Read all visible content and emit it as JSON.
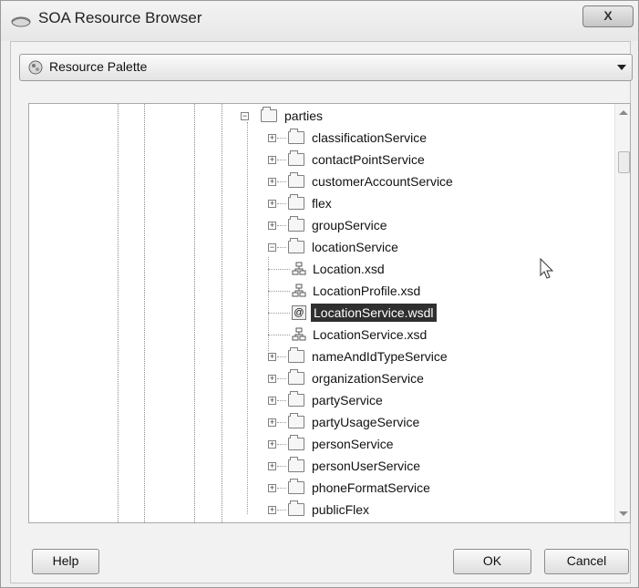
{
  "window": {
    "title": "SOA Resource Browser",
    "close_label": "X"
  },
  "palette": {
    "selected": "Resource Palette"
  },
  "tree": {
    "root": "parties",
    "items": [
      {
        "label": "classificationService"
      },
      {
        "label": "contactPointService"
      },
      {
        "label": "customerAccountService"
      },
      {
        "label": "flex"
      },
      {
        "label": "groupService"
      },
      {
        "label": "locationService"
      },
      {
        "label": "Location.xsd"
      },
      {
        "label": "LocationProfile.xsd"
      },
      {
        "label": "LocationService.wsdl"
      },
      {
        "label": "LocationService.xsd"
      },
      {
        "label": "nameAndIdTypeService"
      },
      {
        "label": "organizationService"
      },
      {
        "label": "partyService"
      },
      {
        "label": "partyUsageService"
      },
      {
        "label": "personService"
      },
      {
        "label": "personUserService"
      },
      {
        "label": "phoneFormatService"
      },
      {
        "label": "publicFlex"
      }
    ]
  },
  "buttons": {
    "help": "Help",
    "ok": "OK",
    "cancel": "Cancel"
  },
  "colors": {
    "selection": "#2f2f2f",
    "window_bg": "#eeeeee"
  }
}
